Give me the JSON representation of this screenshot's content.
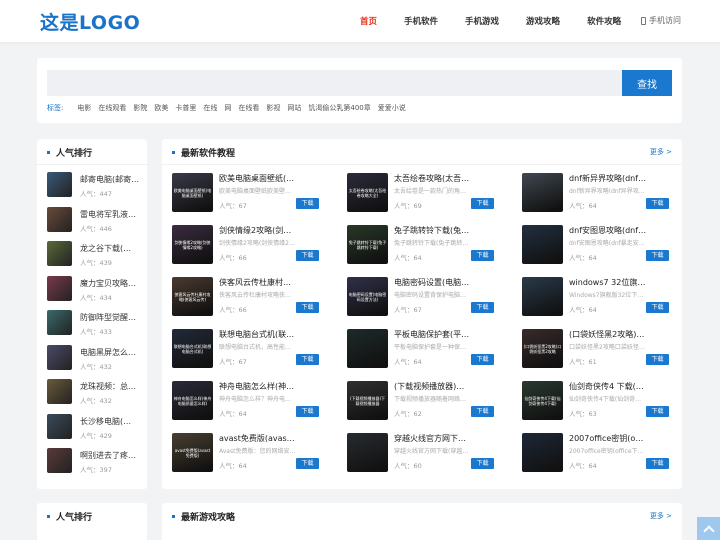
{
  "header": {
    "logo": "这是LOGO",
    "nav": [
      "首页",
      "手机软件",
      "手机游戏",
      "游戏攻略",
      "软件攻略"
    ],
    "mobile": "手机访问"
  },
  "search": {
    "placeholder": "",
    "button": "查找",
    "tags_label": "标签:",
    "tags": [
      "电影",
      "在线观看",
      "影院",
      "欧美",
      "卡普里",
      "在线",
      "网",
      "在线看",
      "影视",
      "网站",
      "饥渴偷公乳第400章",
      "爱爱小说"
    ]
  },
  "ranking": {
    "title": "人气排行",
    "items": [
      {
        "title": "邮寄电脑(邮寄电脑…",
        "popularity": "人气：447"
      },
      {
        "title": "雷电将军乳液…",
        "popularity": "人气：446"
      },
      {
        "title": "龙之谷下载(…",
        "popularity": "人气：439"
      },
      {
        "title": "魔力宝贝攻略…",
        "popularity": "人气：434"
      },
      {
        "title": "防御阵型觉醒…",
        "popularity": "人气：433"
      },
      {
        "title": "电脑黑屏怎么…",
        "popularity": "人气：432"
      },
      {
        "title": "龙珠视频：总…",
        "popularity": "人气：432"
      },
      {
        "title": "长沙移电脑(…",
        "popularity": "人气：429"
      },
      {
        "title": "啊别进去了疼…",
        "popularity": "人气：397"
      }
    ]
  },
  "software": {
    "title": "最新软件教程",
    "more": "更多 >",
    "download_label": "下载",
    "items": [
      {
        "title": "欧美电脑桌面壁纸(电脑桌…",
        "desc": "欧美电脑桌面壁纸欧美壁纸欧美唯…",
        "popularity": "人气：67",
        "cap": "欧美电脑桌面壁纸(电脑桌面壁纸)",
        "color": "#3a3a4a"
      },
      {
        "title": "太吾绘卷攻略(太吾绘卷攻…",
        "desc": "太吾绘卷是一款热门的角色扮演游…",
        "popularity": "人气：69",
        "cap": "太吾绘卷攻略(太吾绘卷攻略大全)",
        "color": "#2c2c3c"
      },
      {
        "title": "dnf新异界攻略(dnf异界攻…",
        "desc": "dnf新异界攻略(dnf异界攻略视频)…",
        "popularity": "人气：64",
        "cap": "",
        "color": "#404850"
      },
      {
        "title": "剑侠情缘2攻略(剑侠情缘2…",
        "desc": "剑侠情缘2攻略(剑侠情缘2攻略游…",
        "popularity": "人气：66",
        "cap": "剑侠情缘2攻略(剑侠情缘2攻略)",
        "color": "#3a2c40"
      },
      {
        "title": "兔子跳转铃下载(兔子跳转…",
        "desc": "兔子跳转铃下载(兔子跳转铃下…",
        "popularity": "人气：64",
        "cap": "兔子跳转铃下载(兔子跳转铃下载)",
        "color": "#283828"
      },
      {
        "title": "dnf安图恩攻略(dnf暴走安…",
        "desc": "dnf安图恩攻略(dnf暴走安图恩攻略)…",
        "popularity": "人气：64",
        "cap": "",
        "color": "#223040"
      },
      {
        "title": "侠客风云传杜康村攻略(侠…",
        "desc": "侠客风云传杜康村攻略侠客风云传…",
        "popularity": "人气：66",
        "cap": "侠客风云传杜康村攻略(侠客风云传)",
        "color": "#4a3a30"
      },
      {
        "title": "电脑密码设置(电脑密码设…",
        "desc": "电脑密码设置背保护电脑安全和隐…",
        "popularity": "人气：67",
        "cap": "电脑密码设置(电脑密码设置方法)",
        "color": "#30304a"
      },
      {
        "title": "windows7 32位旗舰版下…",
        "desc": "Windows7旗舰版32位下载什么是W…",
        "popularity": "人气：64",
        "cap": "",
        "color": "#2a3a4a"
      },
      {
        "title": "联想电脑台式机(联想电脑…",
        "desc": "联想电脑台式机，高性能、易管用…",
        "popularity": "人气：67",
        "cap": "联想电脑台式机(联想电脑台式机)",
        "color": "#222a38"
      },
      {
        "title": "平板电脑保护套(平板电脑…",
        "desc": "平板电脑保护套是一种保护平板电…",
        "popularity": "人气：64",
        "cap": "",
        "color": "#1e2a2a"
      },
      {
        "title": "(口袋妖怪黑2攻略)口袋妖…",
        "desc": "口袋妖怪黑2攻略口袋妖怪黑2是任…",
        "popularity": "人气：61",
        "cap": "(口袋妖怪黑2攻略)口袋妖怪黑2攻略",
        "color": "#382a2a"
      },
      {
        "title": "神舟电脑怎么样(神舟电脑…",
        "desc": "神舟电脑怎么样？神舟电脑是中国…",
        "popularity": "人气：64",
        "cap": "神舟电脑怎么样(神舟电脑质量怎么样)",
        "color": "#2a2a3a"
      },
      {
        "title": "(下载视频播放器)下载视…",
        "desc": "下载视频播放器随着网络的普及…",
        "popularity": "人气：62",
        "cap": "(下载视频播放器)下载视频播放器",
        "color": "#303030"
      },
      {
        "title": "仙剑奇侠传4 下载(仙剑奇…",
        "desc": "仙剑奇侠传4下载(仙剑奇侠传4下载)…",
        "popularity": "人气：63",
        "cap": "仙剑奇侠传4下载(仙剑奇侠传4下载)",
        "color": "#2a3a30"
      },
      {
        "title": "avast免费版(avast免费版…",
        "desc": "Avast免费版：您的网络安全的首选…",
        "popularity": "人气：64",
        "cap": "avast免费版(avast免费版)",
        "color": "#4a4030"
      },
      {
        "title": "穿越火线官方网下载(穿越…",
        "desc": "穿越火线官方网下载(穿越火线国际…",
        "popularity": "人气：60",
        "cap": "",
        "color": "#282c30"
      },
      {
        "title": "2007office密钥(office下载)",
        "desc": "2007office密钥(office下载什么是20…",
        "popularity": "人气：64",
        "cap": "",
        "color": "#1e2838"
      }
    ]
  },
  "ranking2": {
    "title": "人气排行"
  },
  "games": {
    "title": "最新游戏攻略",
    "more": "更多 >"
  },
  "colors": {
    "accent": "#1a73c9",
    "nav_active": "#e5321e",
    "button": "#1a78cf"
  }
}
